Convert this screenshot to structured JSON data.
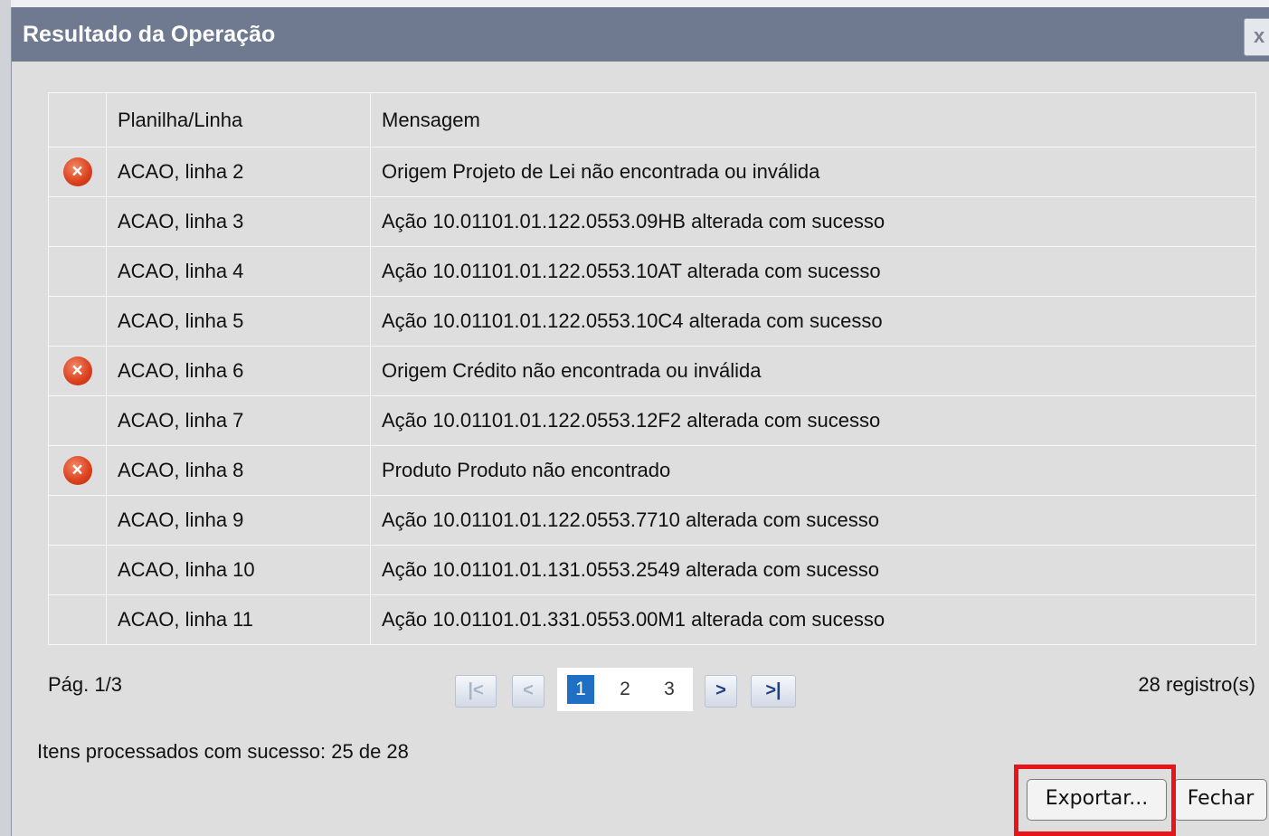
{
  "dialog": {
    "title": "Resultado da Operação",
    "close_label": "x"
  },
  "table": {
    "columns": [
      "",
      "Planilha/Linha",
      "Mensagem"
    ],
    "rows": [
      {
        "error": true,
        "sheet_line": "ACAO, linha 2",
        "message": "Origem Projeto de Lei não encontrada ou inválida"
      },
      {
        "error": false,
        "sheet_line": "ACAO, linha 3",
        "message": "Ação 10.01101.01.122.0553.09HB alterada com sucesso"
      },
      {
        "error": false,
        "sheet_line": "ACAO, linha 4",
        "message": "Ação 10.01101.01.122.0553.10AT alterada com sucesso"
      },
      {
        "error": false,
        "sheet_line": "ACAO, linha 5",
        "message": "Ação 10.01101.01.122.0553.10C4 alterada com sucesso"
      },
      {
        "error": true,
        "sheet_line": "ACAO, linha 6",
        "message": "Origem Crédito não encontrada ou inválida"
      },
      {
        "error": false,
        "sheet_line": "ACAO, linha 7",
        "message": "Ação 10.01101.01.122.0553.12F2 alterada com sucesso"
      },
      {
        "error": true,
        "sheet_line": "ACAO, linha 8",
        "message": "Produto Produto não encontrado"
      },
      {
        "error": false,
        "sheet_line": "ACAO, linha 9",
        "message": "Ação 10.01101.01.122.0553.7710 alterada com sucesso"
      },
      {
        "error": false,
        "sheet_line": "ACAO, linha 10",
        "message": "Ação 10.01101.01.131.0553.2549 alterada com sucesso"
      },
      {
        "error": false,
        "sheet_line": "ACAO, linha 11",
        "message": "Ação 10.01101.01.331.0553.00M1 alterada com sucesso"
      }
    ]
  },
  "pager": {
    "page_label": "Pág. 1/3",
    "count_label": "28 registro(s)",
    "first_icon": "|<",
    "prev_icon": "<",
    "next_icon": ">",
    "last_icon": ">|",
    "pages": [
      "1",
      "2",
      "3"
    ],
    "current_page": "1"
  },
  "summary": "Itens processados com sucesso: 25 de 28",
  "buttons": {
    "export_label": "Exportar...",
    "close_label": "Fechar"
  },
  "colors": {
    "titlebar": "#6f7a91",
    "error_icon": "#dd4420",
    "current_page": "#1f6fc5",
    "highlight_box": "#e8141a"
  },
  "icons": {
    "error": "error-x-circle-icon"
  }
}
